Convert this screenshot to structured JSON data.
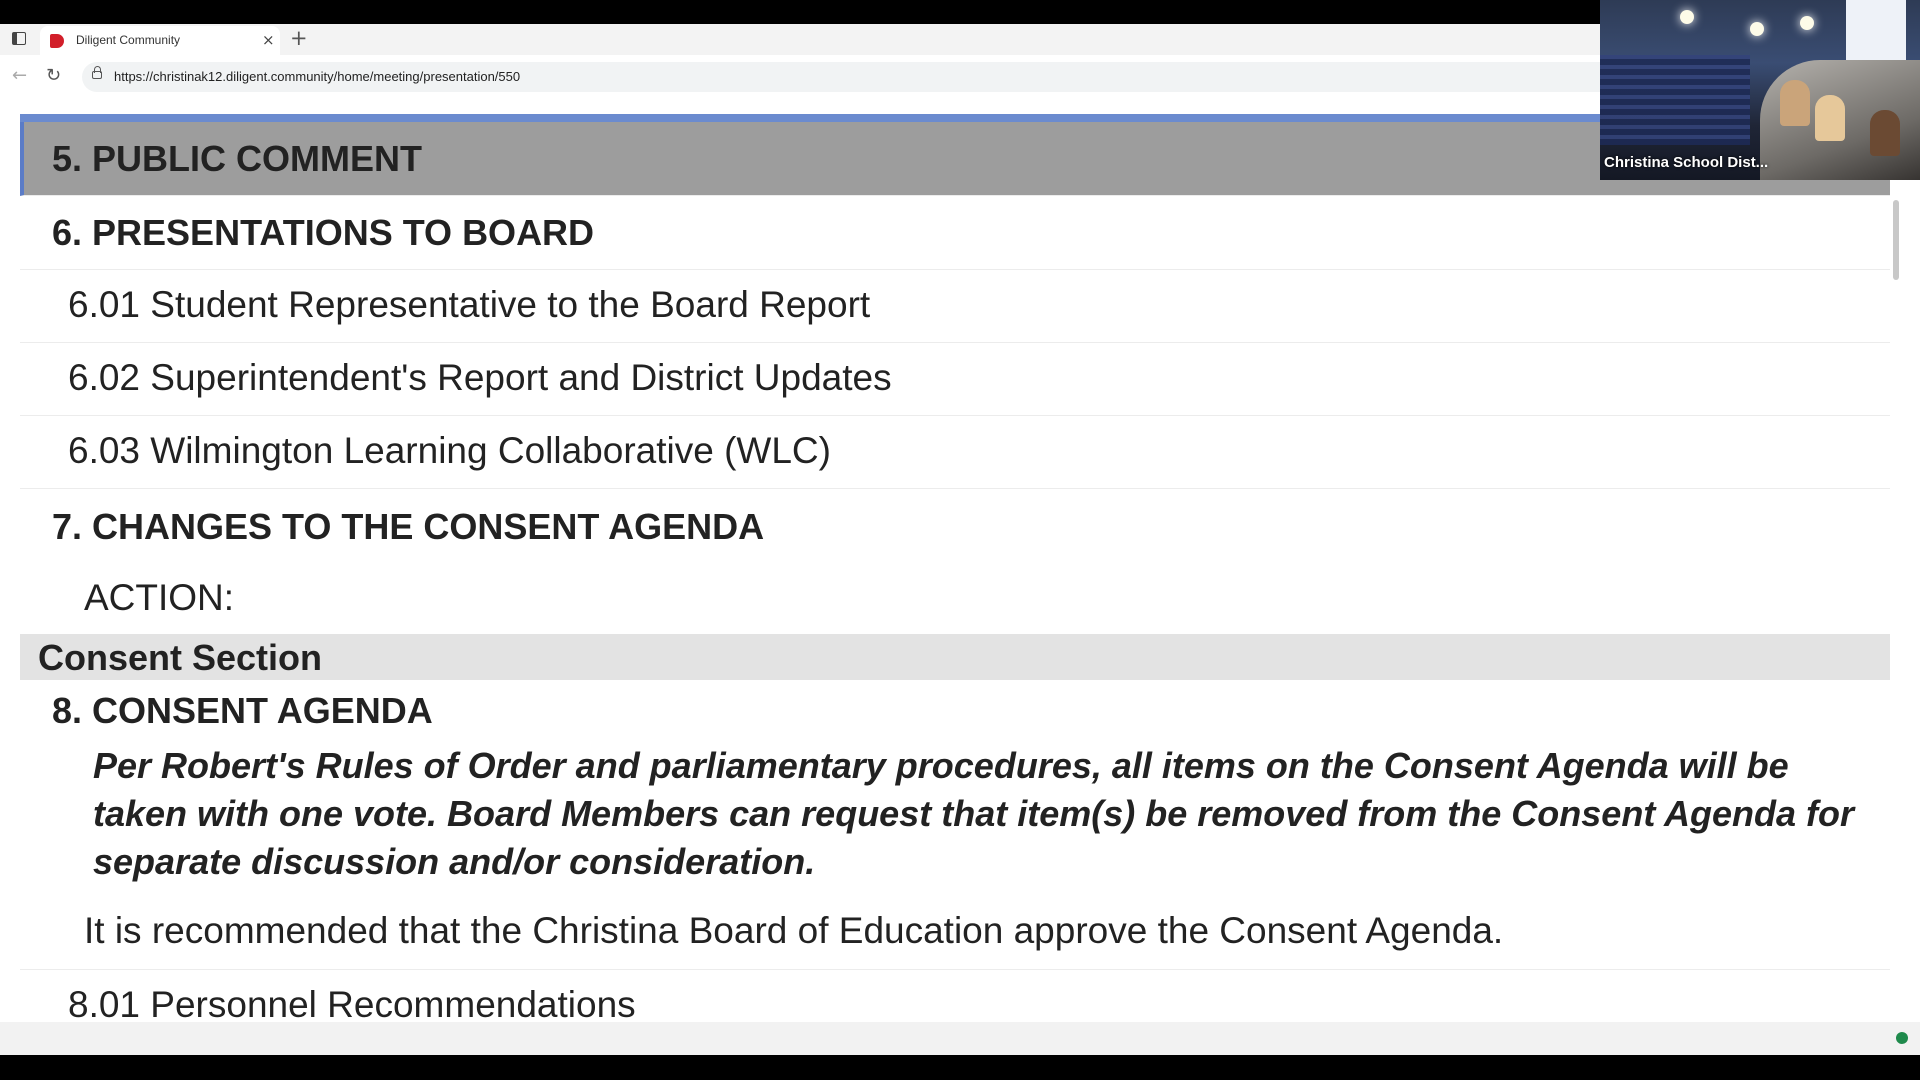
{
  "browser": {
    "tab_title": "Diligent Community",
    "close_glyph": "×",
    "new_tab_glyph": "+",
    "back_glyph": "←",
    "reload_glyph": "↻",
    "url": "https://christinak12.diligent.community/home/meeting/presentation/550"
  },
  "agenda": {
    "public_comment": "5. PUBLIC COMMENT",
    "presentations": "6. PRESENTATIONS TO BOARD",
    "item_601": "6.01 Student Representative to the Board Report",
    "item_602": "6.02 Superintendent's Report and District Updates",
    "item_603": "6.03 Wilmington Learning Collaborative (WLC)",
    "changes_consent": "7. CHANGES TO THE CONSENT AGENDA",
    "action_label": "ACTION:",
    "consent_section": "Consent Section",
    "consent_agenda": "8. CONSENT AGENDA",
    "consent_note": "Per Robert's Rules of Order and parliamentary procedures, all items on the Consent Agenda will be taken with one vote. Board Members can request that item(s) be removed from the Consent Agenda for separate discussion and/or consideration.",
    "recommendation": "It is recommended that the Christina Board of Education approve the Consent Agenda.",
    "item_801": "8.01 Personnel Recommendations"
  },
  "video": {
    "label": "Christina School Dist..."
  },
  "colors": {
    "accent_blue": "#6b8bcf",
    "highlight_gray": "#9d9d9d",
    "status_green": "#1f8a4c",
    "favicon_red": "#d21f2a"
  }
}
